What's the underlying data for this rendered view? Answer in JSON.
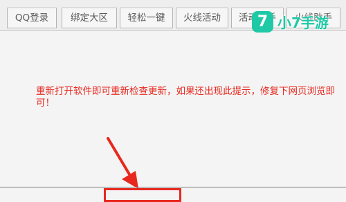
{
  "toolbar": {
    "buttons": [
      {
        "label": "QQ登录"
      },
      {
        "label": "绑定大区"
      },
      {
        "label": "轻松一键"
      },
      {
        "label": "火线活动"
      },
      {
        "label": "活动助手"
      },
      {
        "label": "火线助手"
      }
    ]
  },
  "content": {
    "hint_text": "重新打开软件即可重新检查更新，如果还出现此提示，修复下网页浏览即可！"
  },
  "watermark": {
    "logo_char": "7",
    "text": "小7手游",
    "color": "#1fc9a6"
  },
  "colors": {
    "hint": "#e8281e",
    "annotation": "#e8281e"
  }
}
